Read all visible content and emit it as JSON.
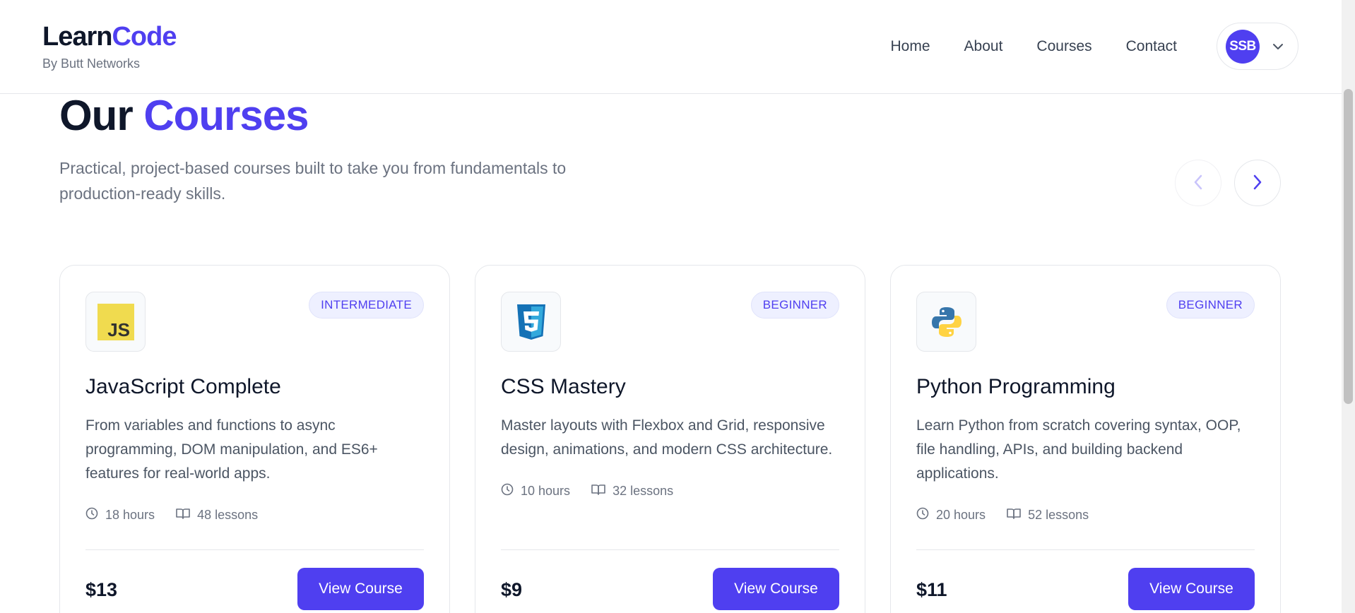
{
  "brand": {
    "learn": "Learn",
    "code": "Code",
    "subtitle": "By Butt Networks"
  },
  "nav": {
    "items": [
      "Home",
      "About",
      "Courses",
      "Contact"
    ]
  },
  "user": {
    "initials": "SSB"
  },
  "hero": {
    "title_a": "Our",
    "title_b": "Courses",
    "description": "Practical, project-based courses built to take you from fundamentals to production-ready skills."
  },
  "colors": {
    "accent": "#4f3ff0",
    "text": "#0f172a",
    "muted": "#6b7280",
    "border": "#e5e7eb"
  },
  "courses": [
    {
      "icon": "javascript-logo-icon",
      "level": "INTERMEDIATE",
      "title": "JavaScript Complete",
      "description": "From variables and functions to async programming, DOM manipulation, and ES6+ features for real-world apps.",
      "hours": "18 hours",
      "lessons": "48 lessons",
      "price": "$13",
      "button": "View Course"
    },
    {
      "icon": "css3-logo-icon",
      "level": "BEGINNER",
      "title": "CSS Mastery",
      "description": "Master layouts with Flexbox and Grid, responsive design, animations, and modern CSS architecture.",
      "hours": "10 hours",
      "lessons": "32 lessons",
      "price": "$9",
      "button": "View Course"
    },
    {
      "icon": "python-logo-icon",
      "level": "BEGINNER",
      "title": "Python Programming",
      "description": "Learn Python from scratch covering syntax, OOP, file handling, APIs, and building backend applications.",
      "hours": "20 hours",
      "lessons": "52 lessons",
      "price": "$11",
      "button": "View Course"
    }
  ]
}
